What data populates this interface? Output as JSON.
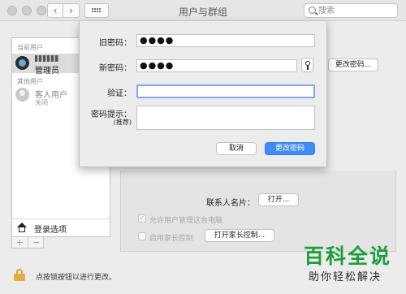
{
  "window": {
    "title": "用户与群组"
  },
  "search": {
    "placeholder": "搜索"
  },
  "sidebar": {
    "current_users_label": "当前用户",
    "current_user": {
      "name": "",
      "role": "管理员"
    },
    "other_users_label": "其他用户",
    "guest": {
      "name": "客人用户",
      "status": "关闭"
    },
    "login_options_label": "登录选项",
    "add_label": "+",
    "remove_label": "−"
  },
  "main": {
    "change_password_button": "更改密码...",
    "contact_card_label": "联系人名片：",
    "open_button": "打开...",
    "allow_admin_label": "允许用户管理这台电脑",
    "parental_controls_label": "启用家长控制",
    "open_parental_controls_button": "打开家长控制...",
    "allow_admin_checked": true,
    "parental_controls_checked": false
  },
  "dialog": {
    "old_password_label": "旧密码：",
    "old_password_value": "●●●●",
    "new_password_label": "新密码：",
    "new_password_value": "●●●●",
    "verify_label": "验证：",
    "verify_value": "",
    "hint_label": "密码提示：",
    "hint_sublabel": "(推荐)",
    "hint_value": "",
    "cancel_button": "取消",
    "confirm_button": "更改密码"
  },
  "footer": {
    "lock_text": "点按锁按钮以进行更改。"
  },
  "watermark": {
    "title": "百科全说",
    "subtitle": "助你轻松解决"
  },
  "colors": {
    "accent": "#3e8cf5",
    "focus_ring": "#7ea9e8",
    "lock": "#e2ad3b",
    "watermark_green": "#1e9e3a"
  },
  "icons": [
    "search-icon",
    "key-icon",
    "house-icon",
    "lock-icon",
    "grid-icon",
    "chevron-left-icon",
    "chevron-right-icon"
  ]
}
